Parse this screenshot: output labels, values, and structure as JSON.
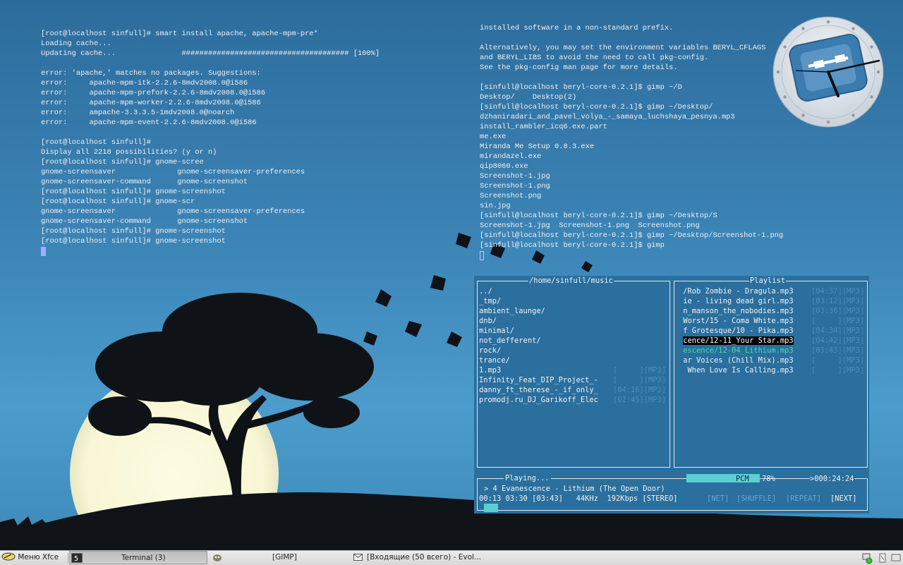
{
  "terminal_left": {
    "lines": [
      "[root@localhost sinfull]# smart install apache, apache-mpm-pre*",
      "Loading cache...",
      "Updating cache...               ###################################### [100%]",
      "",
      "error: 'apache,' matches no packages. Suggestions:",
      "error:     apache-mpm-itk-2.2.6-8mdv2008.0@i586",
      "error:     apache-mpm-prefork-2.2.6-8mdv2008.0@i586",
      "error:     apache-mpm-worker-2.2.6-8mdv2008.0@i586",
      "error:     ampache-3.3.3.5-1mdv2008.0@noarch",
      "error:     apache-mpm-event-2.2.6-8mdv2008.0@i586",
      "",
      "[root@localhost sinfull]#",
      "Display all 2218 possibilities? (y or n)",
      "[root@localhost sinfull]# gnome-scree",
      "gnome-screensaver              gnome-screensaver-preferences",
      "gnome-screensaver-command      gnome-screenshot",
      "[root@localhost sinfull]# gnome-screenshot",
      "[root@localhost sinfull]# gnome-scr",
      "gnome-screensaver              gnome-screensaver-preferences",
      "gnome-screensaver-command      gnome-screenshot",
      "[root@localhost sinfull]# gnome-screenshot",
      "[root@localhost sinfull]# gnome-screenshot"
    ]
  },
  "terminal_right": {
    "lines": [
      "installed software in a non-standard prefix.",
      "",
      "Alternatively, you may set the environment variables BERYL_CFLAGS",
      "and BERYL_LIBS to avoid the need to call pkg-config.",
      "See the pkg-config man page for more details.",
      "",
      "[sinfull@localhost beryl-core-0.2.1]$ gimp ~/D",
      "Desktop/    Desktop(2)",
      "[sinfull@localhost beryl-core-0.2.1]$ gimp ~/Desktop/",
      "dzhaniradari_and_pavel_volya_-_samaya_luchshaya_pesnya.mp3",
      "install_rambler_icq6.exe.part",
      "me.exe",
      "Miranda Me Setup 0.8.3.exe",
      "mirandazel.exe",
      "qip8060.exe",
      "Screenshot-1.jpg",
      "Screenshot-1.png",
      "Screenshot.png",
      "sin.jpg",
      "[sinfull@localhost beryl-core-0.2.1]$ gimp ~/Desktop/S",
      "Screenshot-1.jpg  Screenshot-1.png  Screenshot.png",
      "[sinfull@localhost beryl-core-0.2.1]$ gimp ~/Desktop/Screenshot-1.png",
      "[sinfull@localhost beryl-core-0.2.1]$ gimp"
    ]
  },
  "player": {
    "dir_title": "/home/sinfull/music",
    "dir_items": [
      {
        "name": "../",
        "dur": ""
      },
      {
        "name": "_tmp/",
        "dur": ""
      },
      {
        "name": "ambient_launge/",
        "dur": ""
      },
      {
        "name": "dnb/",
        "dur": ""
      },
      {
        "name": "minimal/",
        "dur": ""
      },
      {
        "name": "not_defferent/",
        "dur": ""
      },
      {
        "name": "rock/",
        "dur": ""
      },
      {
        "name": "trance/",
        "dur": ""
      },
      {
        "name": "1.mp3",
        "dur": "[     ][MP3]"
      },
      {
        "name": "Infinity_Feat_DIP_Project_-",
        "dur": "[     ][MP3]"
      },
      {
        "name": "danny_ft_therese_-_if_only_",
        "dur": "[04:16][MP3]"
      },
      {
        "name": "promodj.ru_DJ_Garikoff_Elec",
        "dur": "[02:45][MP3]"
      }
    ],
    "playlist_title": "Playlist",
    "playlist_items": [
      {
        "name": "/Rob Zombie - Dragula.mp3",
        "dur": "[04:37][MP3]"
      },
      {
        "name": "ie - living dead girl.mp3",
        "dur": "[03:12][MP3]"
      },
      {
        "name": "n_manson_the_nobodies.mp3",
        "dur": "[03:36][MP3]"
      },
      {
        "name": "Worst/15 - Coma White.mp3",
        "dur": "[     ][MP3]"
      },
      {
        "name": "f Grotesque/10 - Pika.mp3",
        "dur": "[04:34][MP3]"
      },
      {
        "name": "cence/12-11_Your Star.mp3",
        "dur": "[04:42][MP3]"
      },
      {
        "name": "escence/12-04_Lithium.mp3",
        "dur": "[03:43][MP3]"
      },
      {
        "name": "ar Voices (Chill Mix).mp3",
        "dur": "[     ][MP3]"
      },
      {
        "name": " When Love Is Calling.mp3",
        "dur": "[     ][MP3]"
      }
    ],
    "selected_index": 5,
    "playing_index": 6,
    "playing_label": "Playing...",
    "pcm_label": "PCM",
    "pcm_value": "78%",
    "remaining_time": ">000:24:24",
    "now_playing": "> 4 Evanescence - Lithium (The Open Door)",
    "status_info": "00:13 03:30 [03:43]   44KHz  192Kbps [STEREO]",
    "flag_net": "[NET]",
    "flag_shuffle": "[SHUFFLE]",
    "flag_repeat": "[REPEAT]",
    "flag_next": "[NEXT]",
    "volume_fraction": 0.78
  },
  "taskbar": {
    "menu_label": "Меню Xfce",
    "terminal_label": "Terminal (3)",
    "gimp_label": "[GIMP]",
    "mail_label": "[Входящие (50 всего) - Evol..."
  }
}
